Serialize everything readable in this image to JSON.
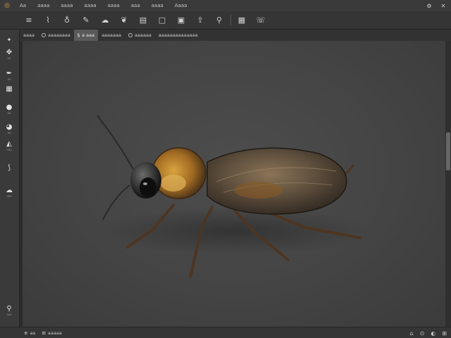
{
  "menubar": {
    "logo_icon": "app-logo",
    "items": [
      "Aa",
      "aaaa",
      "aaaa",
      "aaaa",
      "aaaa",
      "aaa",
      "aaaa",
      "Aaaa"
    ],
    "minimize_glyph": "⚙",
    "close_glyph": "✕"
  },
  "options": {
    "buttons": [
      {
        "name": "align-icon",
        "glyph": "≡"
      },
      {
        "name": "brush-stroke-icon",
        "glyph": "⌇"
      },
      {
        "name": "drop-icon",
        "glyph": "♁"
      },
      {
        "name": "pen-icon",
        "glyph": "✎"
      },
      {
        "name": "cloud-icon",
        "glyph": "☁"
      },
      {
        "name": "tree-icon",
        "glyph": "❦"
      },
      {
        "name": "layers-icon",
        "glyph": "▤"
      },
      {
        "name": "square-icon",
        "glyph": "□"
      },
      {
        "name": "panel-icon",
        "glyph": "▣"
      },
      {
        "name": "export-icon",
        "glyph": "⇪"
      },
      {
        "name": "pin-icon",
        "glyph": "⚲"
      },
      {
        "name": "document-icon",
        "glyph": "▦"
      },
      {
        "name": "chat-icon",
        "glyph": "☏"
      }
    ]
  },
  "tabs": [
    {
      "label": "aaaa",
      "active": false
    },
    {
      "label": "aaaaaaaa",
      "active": false
    },
    {
      "label": "a aaa",
      "active": true
    },
    {
      "label": "aaaaaaa",
      "active": false
    },
    {
      "label": "aaaaaa",
      "active": false
    },
    {
      "label": "aaaaaaaaaaaaaa",
      "active": false
    }
  ],
  "tools": [
    {
      "name": "move-tool-icon",
      "glyph": "✥",
      "label": "aa"
    },
    {
      "name": "brush-tool-icon",
      "glyph": "✒",
      "label": "aa"
    },
    {
      "name": "grid-tool-icon",
      "glyph": "▦",
      "label": ""
    },
    {
      "name": "circle-tool-icon",
      "glyph": "●",
      "label": "aa"
    },
    {
      "name": "fill-tool-icon",
      "glyph": "◕",
      "label": "aa"
    },
    {
      "name": "shape-tool-icon",
      "glyph": "◭",
      "label": "aaa"
    },
    {
      "name": "lasso-tool-icon",
      "glyph": "⟆",
      "label": ""
    },
    {
      "name": "chat-tool-icon",
      "glyph": "☁",
      "label": "aaa"
    },
    {
      "name": "zoom-tool-icon",
      "glyph": "⚲",
      "label": "aaa"
    }
  ],
  "status": {
    "left_text": "aa",
    "doc_info": "aaaaa",
    "right_icons": [
      "⌂",
      "⊙",
      "◐",
      "⊞"
    ]
  }
}
